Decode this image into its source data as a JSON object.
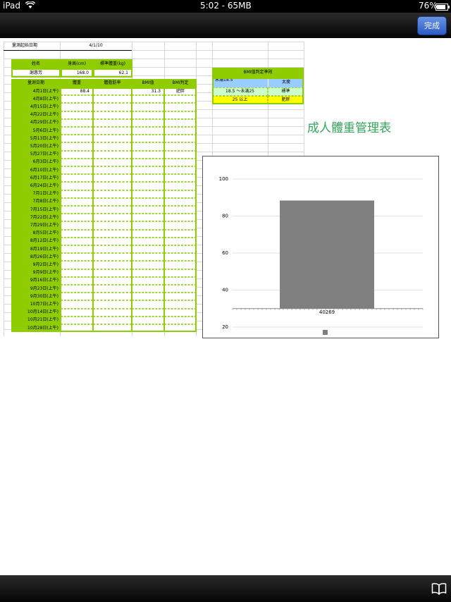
{
  "status_bar": {
    "device": "iPad",
    "time": "5:02 - 65MB",
    "battery": "76%"
  },
  "toolbar": {
    "done_label": "完成"
  },
  "sheet": {
    "start_label": "量測起始日期",
    "start_date": "4/1/10",
    "name_header": "姓名",
    "height_header": "身高(cm)",
    "std_weight_header": "標準體重(kg)",
    "name": "謝惠芳",
    "height": "168.0",
    "std_weight": "62.1",
    "col_headers": [
      "量測日期",
      "體重",
      "體脂肪率",
      "BMI值",
      "BMI判定"
    ],
    "dates": [
      "4月1日(上午)",
      "4月8日(上午)",
      "4月15日(上午)",
      "4月22日(上午)",
      "4月29日(上午)",
      "5月6日(上午)",
      "5月13日(上午)",
      "5月20日(上午)",
      "5月27日(上午)",
      "6月3日(上午)",
      "6月10日(上午)",
      "6月17日(上午)",
      "6月24日(上午)",
      "7月1日(上午)",
      "7月8日(上午)",
      "7月15日(上午)",
      "7月22日(上午)",
      "7月29日(上午)",
      "8月5日(上午)",
      "8月12日(上午)",
      "8月19日(上午)",
      "8月26日(上午)",
      "9月2日(上午)",
      "9月9日(上午)",
      "9月16日(上午)",
      "9月23日(上午)",
      "9月30日(上午)",
      "10月7日(上午)",
      "10月14日(上午)",
      "10月21日(上午)",
      "10月28日(上午)"
    ],
    "first_row": {
      "weight": "88.4",
      "bmi": "31.3",
      "judgement": "肥胖"
    }
  },
  "bmi_criteria": {
    "title": "BMI值判定準則",
    "rows": [
      {
        "range": "未滿18.5",
        "label": "太瘦",
        "color": "#99ccff"
      },
      {
        "range": "18.5 ～未滿25",
        "label": "標準",
        "color": "#ccffcc"
      },
      {
        "range": "25 以上",
        "label": "肥胖",
        "color": "#ffff00"
      }
    ]
  },
  "page_title": "成人體重管理表",
  "chart_data": {
    "type": "bar",
    "categories": [
      "40269"
    ],
    "values": [
      88.4
    ],
    "title": "",
    "xlabel": "",
    "ylabel": "",
    "ylim": [
      20,
      100
    ],
    "yticks": [
      20,
      40,
      60,
      80,
      100
    ],
    "bar_color": "#808080",
    "grid": true,
    "legend": "bottom"
  }
}
